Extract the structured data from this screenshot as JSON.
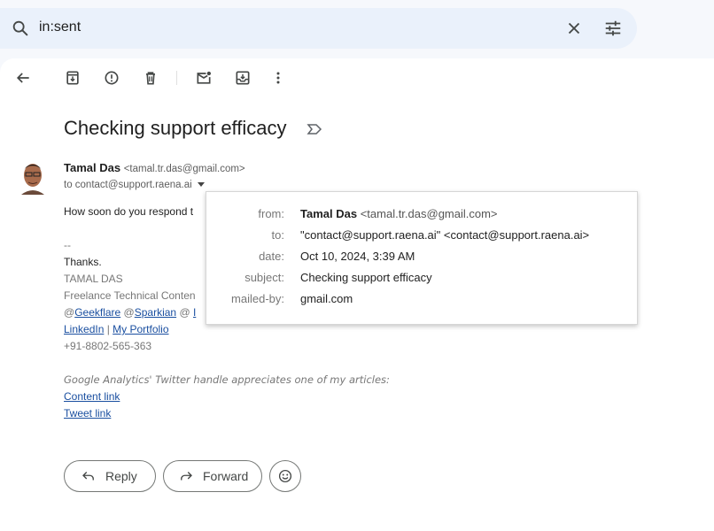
{
  "search": {
    "query": "in:sent",
    "icons": {
      "search": "search-icon",
      "clear": "close-icon",
      "options": "tune-icon"
    }
  },
  "toolbar": {
    "icons": [
      "back-arrow-icon",
      "archive-icon",
      "report-spam-icon",
      "delete-icon",
      "mark-unread-icon",
      "move-to-icon",
      "more-vert-icon"
    ]
  },
  "email": {
    "subject": "Checking support efficacy",
    "label_icon": "important-marker-icon",
    "sender_name": "Tamal Das",
    "sender_email": "<tamal.tr.das@gmail.com>",
    "to_line": "to contact@support.raena.ai",
    "body": {
      "first_line": "How soon do you respond t",
      "sig_dash": "--",
      "thanks": "Thanks.",
      "sig_name": "TAMAL DAS",
      "sig_title": "Freelance Technical Conten",
      "handle_prefix_1": "@",
      "handle_1": "Geekflare",
      "handle_prefix_2": " @",
      "handle_2": "Sparkian",
      "handle_prefix_3": " @ ",
      "handle_3": "I",
      "linkedin": "LinkedIn",
      "separator": " | ",
      "portfolio": "My Portfolio",
      "phone": "+91-8802-565-363",
      "italic_note": "Google Analytics' Twitter handle appreciates one of my articles:",
      "content_link": "Content link",
      "tweet_link": "Tweet link"
    }
  },
  "details_popup": {
    "rows": [
      {
        "key": "from:",
        "name": "Tamal Das",
        "value": "<tamal.tr.das@gmail.com>"
      },
      {
        "key": "to:",
        "value": "\"contact@support.raena.ai\" <contact@support.raena.ai>"
      },
      {
        "key": "date:",
        "value": "Oct 10, 2024, 3:39 AM"
      },
      {
        "key": "subject:",
        "value": "Checking support efficacy"
      },
      {
        "key": "mailed-by:",
        "value": "gmail.com"
      }
    ]
  },
  "actions": {
    "reply": "Reply",
    "forward": "Forward",
    "emoji_icon": "emoji-reaction-icon"
  }
}
